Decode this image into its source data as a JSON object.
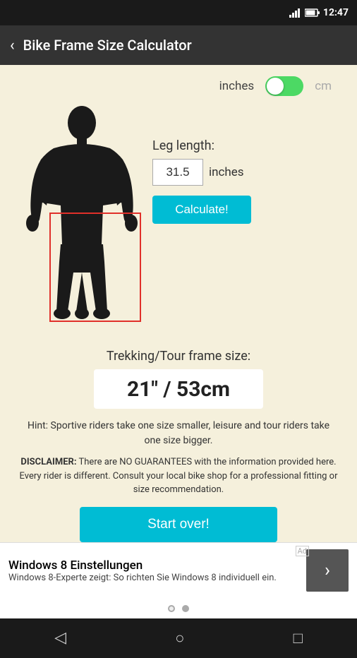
{
  "statusBar": {
    "time": "12:47",
    "signalIcon": "signal",
    "batteryIcon": "battery"
  },
  "topBar": {
    "title": "Bike Frame Size Calculator",
    "backLabel": "‹"
  },
  "unitToggle": {
    "inches_label": "inches",
    "cm_label": "cm",
    "isOn": true
  },
  "form": {
    "legLengthLabel": "Leg length:",
    "legLengthValue": "31.5",
    "unitLabel": "inches",
    "calculateLabel": "Calculate!"
  },
  "result": {
    "frameSizeLabel": "Trekking/Tour frame size:",
    "frameSizeValue": "21\" / 53cm"
  },
  "hint": {
    "text": "Hint: Sportive riders take one size smaller, leisure and tour riders take one size bigger."
  },
  "disclaimer": {
    "boldText": "DISCLAIMER:",
    "text": " There are NO GUARANTEES with the information provided here. Every rider is different. Consult your local bike shop for a professional fitting or size recommendation."
  },
  "startOver": {
    "label": "Start over!"
  },
  "ad": {
    "title": "Windows 8 Einstellungen",
    "subtitle": "Windows 8-Experte zeigt: So richten Sie Windows 8 individuell ein.",
    "adLabel": "Ad",
    "arrowLabel": "›"
  },
  "navBar": {
    "backIcon": "◁",
    "homeIcon": "○",
    "recentIcon": "□"
  }
}
